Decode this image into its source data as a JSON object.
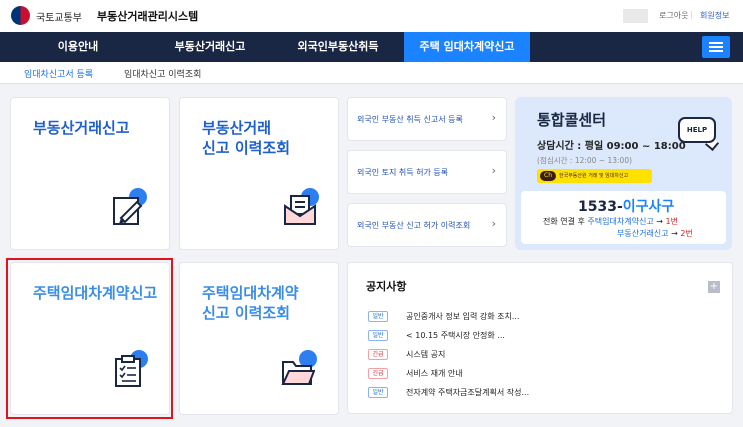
{
  "header": {
    "ministry": "국토교통부",
    "system_name": "부동산거래관리시스템",
    "login": "로그아웃",
    "separator": "|",
    "join": "회원정보"
  },
  "gnb": {
    "items": [
      "이용안내",
      "부동산거래신고",
      "외국인부동산취득",
      "주택 임대차계약신고"
    ],
    "active_index": 3
  },
  "subnav": {
    "items": [
      "임대차신고서 등록",
      "임대차신고 이력조회"
    ]
  },
  "cards": {
    "c1": "부동산거래신고",
    "c2": "부동산거래\n신고 이력조회",
    "c3": "주택임대차계약신고",
    "c4": "주택임대차계약\n신고 이력조회"
  },
  "links": [
    "외국인 부동산 취득 신고서 등록",
    "외국인 토지 취득 허가 등록",
    "외국인 부동산 신고 허가 이력조회"
  ],
  "call_center": {
    "title": "통합콜센터",
    "hours": "상담시간 : 평일 09:00 ~ 18:00",
    "break": "(점심시간 : 12:00 ~ 13:00)",
    "kakao_badge": "Ch",
    "kakao_text": "한국부동산원 거래 및 임대차신고",
    "help": "HELP",
    "number_prefix": "1533-",
    "number_word": "이구사구",
    "conn1_a": "전화 연결 후 ",
    "conn1_b": "주택임대차계약신고",
    "conn1_c": " → ",
    "conn1_d": "1번",
    "conn2_a": "부동산거래신고",
    "conn2_b": " → ",
    "conn2_c": "2번"
  },
  "notice": {
    "title": "공지사항",
    "more": "+",
    "rows": [
      {
        "tag": "일반",
        "text": "공인중개사 정보 입력 강화 조치..."
      },
      {
        "tag": "일반",
        "text": "< 10.15 주택시장 안정화 ..."
      },
      {
        "tag": "긴급",
        "text": "시스템 공지"
      },
      {
        "tag": "긴급",
        "text": "서비스 재개 안내"
      },
      {
        "tag": "일반",
        "text": "전자계약 주택자금조달계획서 작성..."
      }
    ]
  },
  "colors": {
    "navy": "#1a2744",
    "accent": "#1b83ff",
    "highlight": "#e0141e"
  }
}
